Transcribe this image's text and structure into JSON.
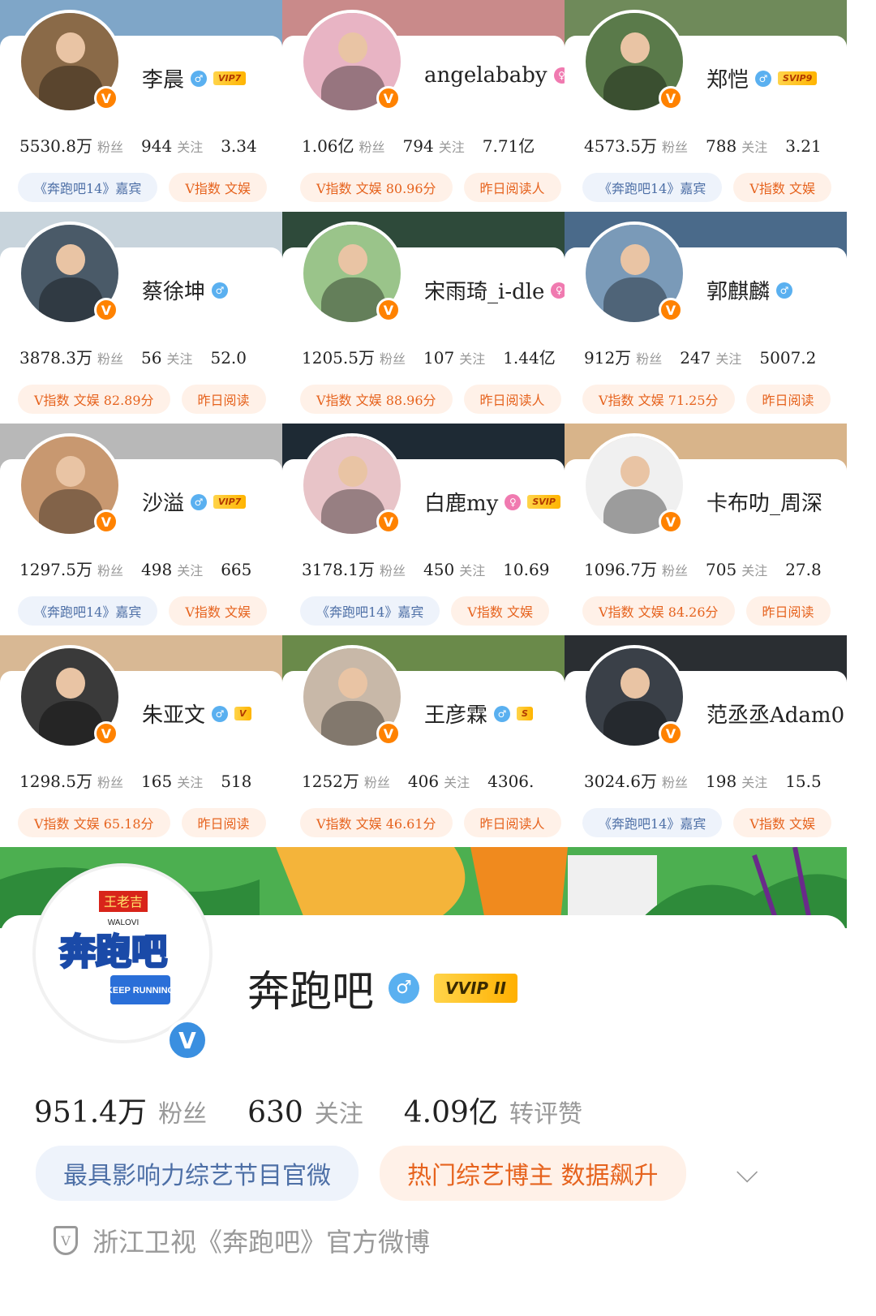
{
  "cards": [
    {
      "name": "李晨",
      "gender": "♂",
      "vip": "VIP7",
      "fans": "5530.8万",
      "fans_label": "粉丝",
      "follow": "944",
      "follow_label": "关注",
      "interact": "3.34",
      "tags": [
        {
          "text": "《奔跑吧14》嘉宾",
          "style": "blue"
        },
        {
          "text": "V指数 文娱",
          "style": "orange"
        }
      ],
      "banner": "#7fa6c8",
      "avatar_bg": "#8a6a48"
    },
    {
      "name": "angelababy",
      "gender": "♀",
      "vip": "",
      "fans": "1.06亿",
      "fans_label": "粉丝",
      "follow": "794",
      "follow_label": "关注",
      "interact": "7.71亿",
      "tags": [
        {
          "text": "V指数 文娱 80.96分",
          "style": "orange"
        },
        {
          "text": "昨日阅读人",
          "style": "orange"
        }
      ],
      "banner": "#c98a8a",
      "avatar_bg": "#e8b4c4"
    },
    {
      "name": "郑恺",
      "gender": "♂",
      "vip": "SVIP9",
      "fans": "4573.5万",
      "fans_label": "粉丝",
      "follow": "788",
      "follow_label": "关注",
      "interact": "3.21",
      "tags": [
        {
          "text": "《奔跑吧14》嘉宾",
          "style": "blue"
        },
        {
          "text": "V指数 文娱",
          "style": "orange"
        }
      ],
      "banner": "#6f8a5a",
      "avatar_bg": "#5a7a4a"
    },
    {
      "name": "蔡徐坤",
      "gender": "♂",
      "vip": "",
      "fans": "3878.3万",
      "fans_label": "粉丝",
      "follow": "56",
      "follow_label": "关注",
      "interact": "52.0",
      "tags": [
        {
          "text": "V指数 文娱 82.89分",
          "style": "orange"
        },
        {
          "text": "昨日阅读",
          "style": "orange"
        }
      ],
      "banner": "#c8d4dc",
      "avatar_bg": "#4a5a68"
    },
    {
      "name": "宋雨琦_i-dle",
      "gender": "♀",
      "vip": "",
      "fans": "1205.5万",
      "fans_label": "粉丝",
      "follow": "107",
      "follow_label": "关注",
      "interact": "1.44亿",
      "tags": [
        {
          "text": "V指数 文娱 88.96分",
          "style": "orange"
        },
        {
          "text": "昨日阅读人",
          "style": "orange"
        }
      ],
      "banner": "#2e4a3a",
      "avatar_bg": "#9ac48a"
    },
    {
      "name": "郭麒麟",
      "gender": "♂",
      "vip": "",
      "fans": "912万",
      "fans_label": "粉丝",
      "follow": "247",
      "follow_label": "关注",
      "interact": "5007.2",
      "tags": [
        {
          "text": "V指数 文娱 71.25分",
          "style": "orange"
        },
        {
          "text": "昨日阅读",
          "style": "orange"
        }
      ],
      "banner": "#4a6a8a",
      "avatar_bg": "#7a9ab8"
    },
    {
      "name": "沙溢",
      "gender": "♂",
      "vip": "VIP7",
      "fans": "1297.5万",
      "fans_label": "粉丝",
      "follow": "498",
      "follow_label": "关注",
      "interact": "665",
      "tags": [
        {
          "text": "《奔跑吧14》嘉宾",
          "style": "blue"
        },
        {
          "text": "V指数 文娱",
          "style": "orange"
        }
      ],
      "banner": "#b8b8b8",
      "avatar_bg": "#c89870"
    },
    {
      "name": "白鹿my",
      "gender": "♀",
      "vip": "SVIP",
      "fans": "3178.1万",
      "fans_label": "粉丝",
      "follow": "450",
      "follow_label": "关注",
      "interact": "10.69",
      "tags": [
        {
          "text": "《奔跑吧14》嘉宾",
          "style": "blue"
        },
        {
          "text": "V指数 文娱",
          "style": "orange"
        }
      ],
      "banner": "#1e2a34",
      "avatar_bg": "#e8c4c8"
    },
    {
      "name": "卡布叻_周深",
      "gender": "",
      "vip": "",
      "fans": "1096.7万",
      "fans_label": "粉丝",
      "follow": "705",
      "follow_label": "关注",
      "interact": "27.8",
      "tags": [
        {
          "text": "V指数 文娱 84.26分",
          "style": "orange"
        },
        {
          "text": "昨日阅读",
          "style": "orange"
        }
      ],
      "banner": "#d8b48a",
      "avatar_bg": "#f0f0f0"
    },
    {
      "name": "朱亚文",
      "gender": "♂",
      "vip": "V",
      "fans": "1298.5万",
      "fans_label": "粉丝",
      "follow": "165",
      "follow_label": "关注",
      "interact": "518",
      "tags": [
        {
          "text": "V指数 文娱 65.18分",
          "style": "orange"
        },
        {
          "text": "昨日阅读",
          "style": "orange"
        }
      ],
      "banner": "#d8b894",
      "avatar_bg": "#3a3a3a"
    },
    {
      "name": "王彦霖",
      "gender": "♂",
      "vip": "S",
      "fans": "1252万",
      "fans_label": "粉丝",
      "follow": "406",
      "follow_label": "关注",
      "interact": "4306.",
      "tags": [
        {
          "text": "V指数 文娱 46.61分",
          "style": "orange"
        },
        {
          "text": "昨日阅读人",
          "style": "orange"
        }
      ],
      "banner": "#6a8a4a",
      "avatar_bg": "#c8b8a8"
    },
    {
      "name": "范丞丞Adam0",
      "gender": "",
      "vip": "",
      "fans": "3024.6万",
      "fans_label": "粉丝",
      "follow": "198",
      "follow_label": "关注",
      "interact": "15.5",
      "tags": [
        {
          "text": "《奔跑吧14》嘉宾",
          "style": "blue"
        },
        {
          "text": "V指数 文娱",
          "style": "orange"
        }
      ],
      "banner": "#2a2e32",
      "avatar_bg": "#3a4048"
    }
  ],
  "main": {
    "name": "奔跑吧",
    "gender": "♂",
    "vip": "VVIP II",
    "logo_top": "王老吉",
    "logo_sub": "WALOVI",
    "logo_main": "奔跑吧",
    "logo_en": "KEEP RUNNING",
    "fans": "951.4万",
    "fans_label": "粉丝",
    "follow": "630",
    "follow_label": "关注",
    "interact": "4.09亿",
    "interact_label": "转评赞",
    "tag_blue": "最具影响力综艺节目官微",
    "tag_orange": "热门综艺博主 数据飙升",
    "desc": "浙江卫视《奔跑吧》官方微博"
  },
  "badge_letter": "V",
  "chevron": "⌵"
}
